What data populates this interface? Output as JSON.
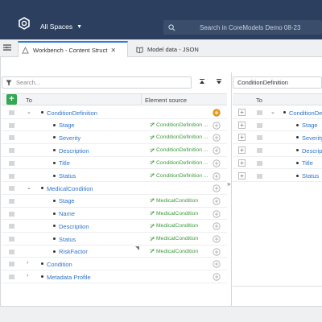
{
  "header": {
    "spaces_label": "All Spaces",
    "search_placeholder": "Search in CoreModels Demo 08-23"
  },
  "tabs": [
    {
      "label": "Workbench - Content Struct"
    },
    {
      "label": "Model data - JSON"
    }
  ],
  "left_panel": {
    "search_placeholder": "Search...",
    "col_to": "To",
    "col_source": "Element source",
    "rows": [
      {
        "label": "ConditionDefinition",
        "source": "",
        "level": 0,
        "expander": "⌄"
      },
      {
        "label": "Stage",
        "source": "ConditionDefinition ...",
        "level": 1
      },
      {
        "label": "Severity",
        "source": "ConditionDefinition ...",
        "level": 1
      },
      {
        "label": "Description",
        "source": "ConditionDefinition ...",
        "level": 1
      },
      {
        "label": "Title",
        "source": "ConditionDefinition ...",
        "level": 1
      },
      {
        "label": "Status",
        "source": "ConditionDefinition ...",
        "level": 1
      },
      {
        "label": "MedicalCondition",
        "source": "",
        "level": 0,
        "expander": "⌄"
      },
      {
        "label": "Stage",
        "source": "MedicalCondition",
        "level": 1
      },
      {
        "label": "Name",
        "source": "MedicalCondition",
        "level": 1
      },
      {
        "label": "Description",
        "source": "MedicalCondition",
        "level": 1
      },
      {
        "label": "Status",
        "source": "MedicalCondition",
        "level": 1
      },
      {
        "label": "RiskFactor",
        "source": "MedicalCondition",
        "level": 1
      },
      {
        "label": "Condition",
        "source": "",
        "level": 0,
        "expander": "›"
      },
      {
        "label": "Metadata Profile",
        "source": "",
        "level": 0,
        "expander": "›"
      }
    ]
  },
  "splitter_glyph": "»",
  "right_panel": {
    "title": "ConditionDefinition",
    "col_to": "To",
    "rows": [
      {
        "label": "ConditionDef",
        "level": 0,
        "expander": "⌄"
      },
      {
        "label": "Stage",
        "level": 1
      },
      {
        "label": "Severity",
        "level": 1
      },
      {
        "label": "Description",
        "level": 1
      },
      {
        "label": "Title",
        "level": 1
      },
      {
        "label": "Status",
        "level": 1
      }
    ]
  },
  "colors": {
    "header_bg": "#2c3f5e",
    "link": "#2f74c9",
    "source_green": "#3c9a3c",
    "add_green": "#32a852",
    "accent": "#f0a020"
  }
}
